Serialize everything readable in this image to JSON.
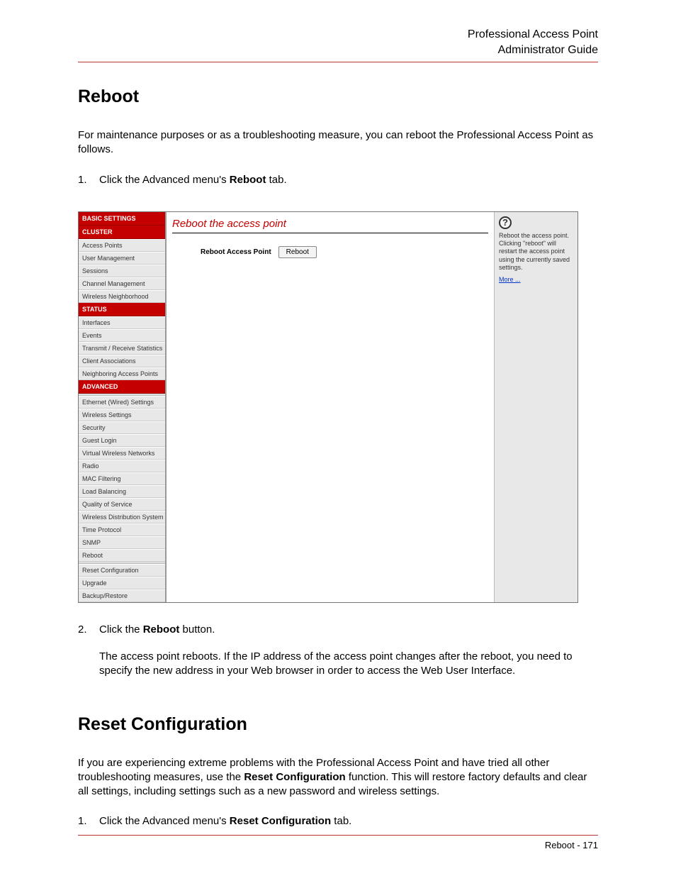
{
  "header": {
    "line1": "Professional Access Point",
    "line2": "Administrator Guide"
  },
  "section1": {
    "title": "Reboot",
    "intro": "For maintenance purposes or as a troubleshooting measure, you can reboot the Professional Access Point as follows.",
    "step1_num": "1.",
    "step1_a": "Click the Advanced menu's ",
    "step1_bold": "Reboot",
    "step1_b": " tab."
  },
  "fig": {
    "sidebar": {
      "basic": "BASIC SETTINGS",
      "cluster_hdr": "CLUSTER",
      "cluster": [
        "Access Points",
        "User Management",
        "Sessions",
        "Channel Management",
        "Wireless Neighborhood"
      ],
      "status_hdr": "STATUS",
      "status": [
        "Interfaces",
        "Events",
        "Transmit / Receive Statistics",
        "Client Associations",
        "Neighboring Access Points"
      ],
      "adv_hdr": "ADVANCED",
      "adv": [
        "Ethernet (Wired) Settings",
        "Wireless Settings",
        "Security",
        "Guest Login",
        "Virtual Wireless Networks",
        "Radio",
        "MAC Filtering",
        "Load Balancing",
        "Quality of Service",
        "Wireless Distribution System",
        "Time Protocol",
        "SNMP",
        "Reboot"
      ],
      "adv2": [
        "Reset Configuration",
        "Upgrade",
        "Backup/Restore"
      ]
    },
    "main": {
      "title": "Reboot the access point",
      "label": "Reboot Access Point",
      "button": "Reboot"
    },
    "help": {
      "text": "Reboot the access point. Clicking \"reboot\" will restart the access point using the currently saved settings.",
      "more": "More ..."
    }
  },
  "step2": {
    "num": "2.",
    "a": "Click the ",
    "bold": "Reboot",
    "b": " button.",
    "sub": "The access point reboots. If the IP address of the access point changes after the reboot, you need to specify the new address in your Web browser in order to access the Web User Interface."
  },
  "section2": {
    "title": "Reset Configuration",
    "intro_a": "If you are experiencing extreme problems with the Professional Access Point and have tried all other troubleshooting measures, use the ",
    "intro_bold": "Reset Configuration",
    "intro_b": " function. This will restore factory defaults and clear all settings, including settings such as a new password and wireless settings.",
    "step1_num": "1.",
    "step1_a": "Click the Advanced menu's ",
    "step1_bold": "Reset Configuration",
    "step1_b": " tab."
  },
  "footer": {
    "text": "Reboot - 171"
  }
}
